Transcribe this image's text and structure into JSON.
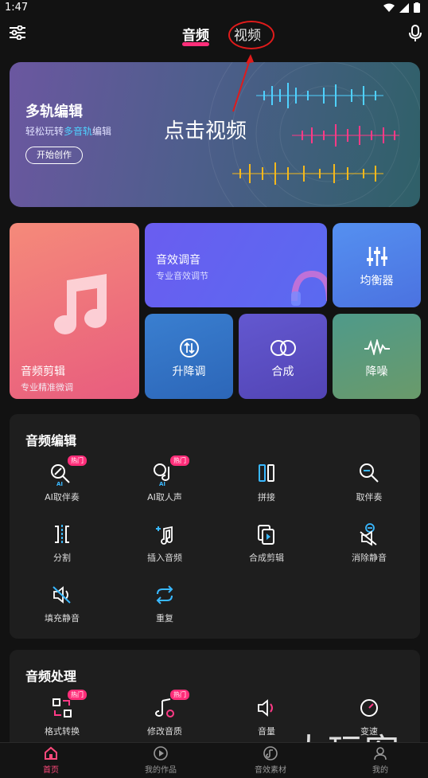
{
  "status": {
    "time": "1:47"
  },
  "topbar": {
    "tab_audio": "音频",
    "tab_video": "视频"
  },
  "hero": {
    "title": "多轨编辑",
    "subtitle_pre": "轻松玩转",
    "subtitle_highlight": "多音轨",
    "subtitle_post": "编辑",
    "button": "开始创作",
    "annotation": "点击视频"
  },
  "cards": {
    "cut": {
      "title": "音频剪辑",
      "sub": "专业精准微调"
    },
    "effects": {
      "title": "音效调音",
      "sub": "专业音效调节"
    },
    "equalizer": {
      "title": "均衡器"
    },
    "pitch": {
      "title": "升降调"
    },
    "mix": {
      "title": "合成"
    },
    "denoise": {
      "title": "降噪"
    }
  },
  "edit_section": {
    "title": "音频编辑",
    "tools": [
      {
        "label": "AI取伴奏",
        "badge": "热门",
        "icon": "ai-accompaniment-icon"
      },
      {
        "label": "AI取人声",
        "badge": "热门",
        "icon": "ai-vocal-icon"
      },
      {
        "label": "拼接",
        "icon": "splice-icon"
      },
      {
        "label": "取伴奏",
        "icon": "accompaniment-icon"
      },
      {
        "label": "分割",
        "icon": "split-icon"
      },
      {
        "label": "插入音频",
        "icon": "insert-audio-icon"
      },
      {
        "label": "合成剪辑",
        "icon": "mix-edit-icon"
      },
      {
        "label": "消除静音",
        "icon": "remove-silence-icon"
      },
      {
        "label": "填充静音",
        "icon": "fill-silence-icon"
      },
      {
        "label": "重复",
        "icon": "repeat-icon"
      }
    ]
  },
  "process_section": {
    "title": "音频处理",
    "tools": [
      {
        "label": "格式转换",
        "badge": "热门",
        "icon": "format-convert-icon"
      },
      {
        "label": "修改音质",
        "badge": "热门",
        "icon": "quality-icon"
      },
      {
        "label": "音量",
        "icon": "volume-icon"
      },
      {
        "label": "变速",
        "icon": "speed-icon"
      }
    ]
  },
  "nav": {
    "home": "首页",
    "works": "我的作品",
    "materials": "音效素材",
    "mine": "我的"
  },
  "watermark": "大玩客",
  "colors": {
    "accent": "#ff2e7a",
    "highlight": "#4fd1ff",
    "annotation": "#e01b1b"
  }
}
